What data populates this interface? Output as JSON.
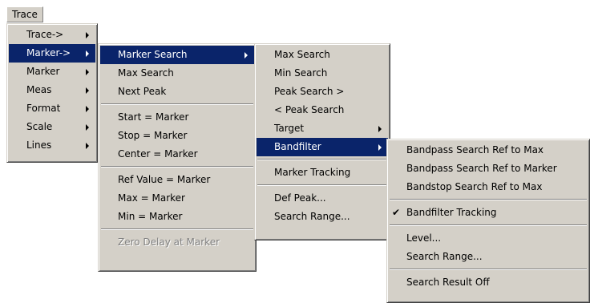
{
  "menubar": {
    "trace_label": "Trace"
  },
  "menu1": {
    "items": [
      "Trace->",
      "Marker->",
      "Marker",
      "Meas",
      "Format",
      "Scale",
      "Lines"
    ]
  },
  "menu2": {
    "items": [
      "Marker Search",
      "Max Search",
      "Next Peak",
      "Start = Marker",
      "Stop = Marker",
      "Center = Marker",
      "Ref Value = Marker",
      "Max = Marker",
      "Min = Marker",
      "Zero Delay at Marker"
    ]
  },
  "menu3": {
    "items": [
      "Max Search",
      "Min Search",
      "Peak Search >",
      "< Peak Search",
      "Target",
      "Bandfilter",
      "Marker Tracking",
      "Def Peak...",
      "Search Range..."
    ]
  },
  "menu4": {
    "items": [
      "Bandpass Search Ref  to Max",
      "Bandpass Search Ref to Marker",
      "Bandstop Search Ref  to Max",
      "Bandfilter Tracking",
      "Level...",
      "Search Range...",
      "Search Result Off"
    ],
    "check_glyph": "✔"
  },
  "colors": {
    "menu_bg": "#d4d0c8",
    "highlight": "#0a246a",
    "disabled_text": "#808080"
  }
}
